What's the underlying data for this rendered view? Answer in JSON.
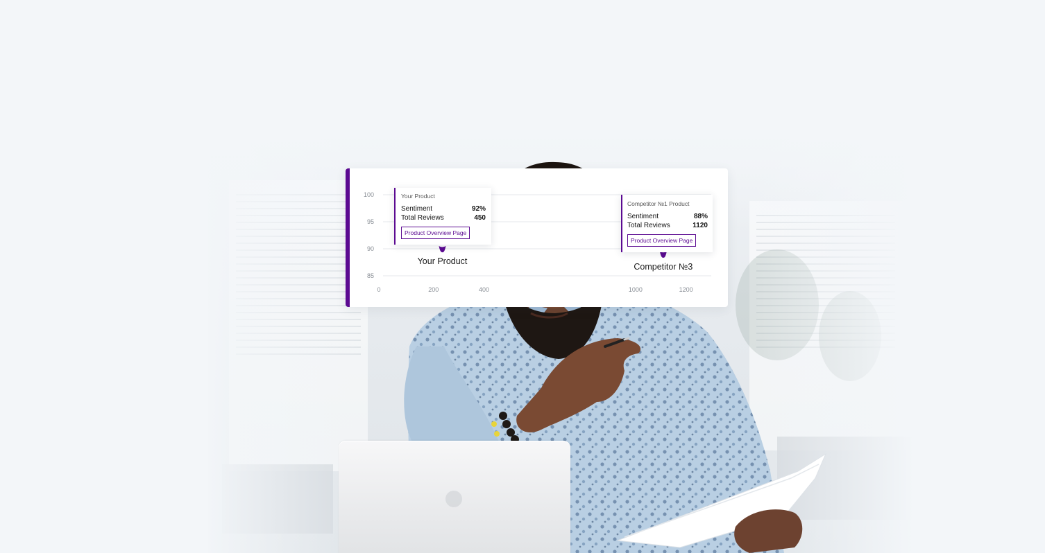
{
  "chart_data": {
    "type": "scatter",
    "title": "",
    "xlabel": "",
    "ylabel": "",
    "xlim": [
      0,
      1300
    ],
    "ylim": [
      85,
      100
    ],
    "grid": true,
    "x_ticks": [
      "0",
      "200",
      "400",
      "1000",
      "1200"
    ],
    "y_ticks": [
      "100",
      "95",
      "90",
      "85"
    ],
    "points": [
      {
        "label": "Your Product",
        "x": 235,
        "y": 90
      },
      {
        "label": "Competitor №3",
        "x": 1110,
        "y": 89
      }
    ]
  },
  "tooltips": [
    {
      "title": "Your Product",
      "sentiment_label": "Sentiment",
      "sentiment_value": "92%",
      "reviews_label": "Total Reviews",
      "reviews_value": "450",
      "button_label": "Product Overview Page"
    },
    {
      "title": "Competitor №1 Product",
      "sentiment_label": "Sentiment",
      "sentiment_value": "88%",
      "reviews_label": "Total Reviews",
      "reviews_value": "1120",
      "button_label": "Product Overview Page"
    }
  ],
  "colors": {
    "accent": "#5b0a91",
    "background": "#f3f6f9"
  },
  "icons": [
    "data-point-marker-icon"
  ]
}
